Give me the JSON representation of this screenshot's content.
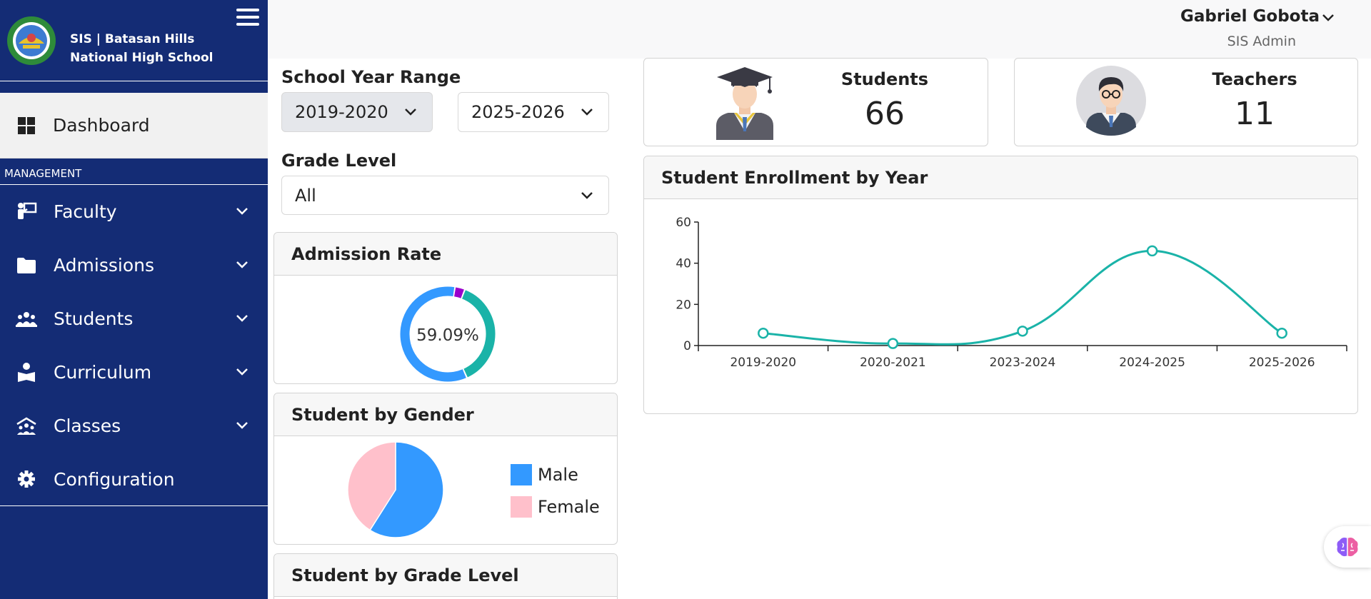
{
  "sidebar": {
    "brand_title": "SIS | Batasan Hills National High School",
    "dashboard_label": "Dashboard",
    "section_label": "MANAGEMENT",
    "items": [
      {
        "label": "Faculty"
      },
      {
        "label": "Admissions"
      },
      {
        "label": "Students"
      },
      {
        "label": "Curriculum"
      },
      {
        "label": "Classes"
      },
      {
        "label": "Configuration"
      }
    ]
  },
  "user": {
    "name": "Gabriel Gobota",
    "role": "SIS Admin"
  },
  "filters": {
    "school_year_label": "School Year Range",
    "year_from": "2019-2020",
    "year_to": "2025-2026",
    "grade_label": "Grade Level",
    "grade_value": "All"
  },
  "stats": {
    "students_label": "Students",
    "students_value": "66",
    "teachers_label": "Teachers",
    "teachers_value": "11"
  },
  "admission": {
    "title": "Admission Rate",
    "rate_text": "59.09%",
    "segments": [
      {
        "value": 59.09,
        "color": "#3399ff"
      },
      {
        "value": 37.5,
        "color": "#1ab3a8"
      },
      {
        "value": 3.41,
        "color": "#9900cc"
      }
    ]
  },
  "gender": {
    "title": "Student by Gender",
    "legend": [
      {
        "label": "Male",
        "color": "#3399ff",
        "value": 59
      },
      {
        "label": "Female",
        "color": "#ffc0cb",
        "value": 41
      }
    ]
  },
  "grade_section": {
    "title": "Student by Grade Level"
  },
  "enrollment": {
    "title": "Student Enrollment by Year"
  },
  "chart_data": {
    "type": "line",
    "title": "Student Enrollment by Year",
    "categories": [
      "2019-2020",
      "2020-2021",
      "2023-2024",
      "2024-2025",
      "2025-2026"
    ],
    "values": [
      6,
      1,
      7,
      46,
      6
    ],
    "ylim": [
      0,
      60
    ],
    "yticks": [
      0,
      20,
      40,
      60
    ],
    "color": "#1ab3a8",
    "grid": false
  }
}
